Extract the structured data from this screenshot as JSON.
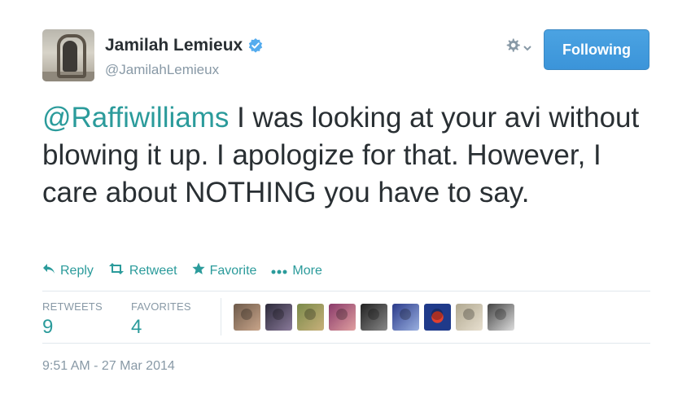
{
  "user": {
    "name": "Jamilah Lemieux",
    "handle": "@JamilahLemieux",
    "verified": true
  },
  "header": {
    "follow_label": "Following",
    "settings_icon": "gear-icon"
  },
  "tweet": {
    "mention": "@Raffiwilliams",
    "text": " I was looking at your avi without blowing it up. I apologize for that. However, I care about NOTHING you have to say."
  },
  "actions": [
    {
      "label": "Reply",
      "icon": "reply-icon"
    },
    {
      "label": "Retweet",
      "icon": "retweet-icon"
    },
    {
      "label": "Favorite",
      "icon": "star-icon"
    },
    {
      "label": "More",
      "icon": "more-icon"
    }
  ],
  "stats": {
    "retweets_label": "RETWEETS",
    "retweets_count": "9",
    "favorites_label": "FAVORITES",
    "favorites_count": "4"
  },
  "avatars_count": 9,
  "timestamp": "9:51 AM - 27 Mar 2014",
  "colors": {
    "accent": "#2b9b9b",
    "follow_button": "#3b94d9",
    "muted_text": "#8899a6",
    "body_text": "#292f33"
  }
}
